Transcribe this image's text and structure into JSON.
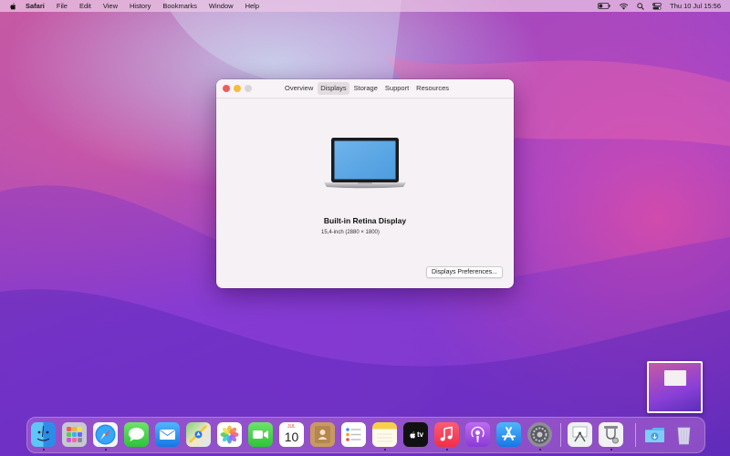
{
  "menubar": {
    "app_name": "Safari",
    "items": [
      "File",
      "Edit",
      "View",
      "History",
      "Bookmarks",
      "Window",
      "Help"
    ],
    "clock": "Thu 10 Jul  15:56",
    "status_icons": [
      "battery-icon",
      "wifi-icon",
      "search-icon",
      "control-center-icon"
    ]
  },
  "window": {
    "tabs": [
      "Overview",
      "Displays",
      "Storage",
      "Support",
      "Resources"
    ],
    "active_tab": "Displays",
    "display_name": "Built-in Retina Display",
    "display_spec": "15,4-inch (2880 × 1800)",
    "preferences_button": "Displays Preferences..."
  },
  "dock": {
    "apps": [
      {
        "name": "Finder",
        "icon": "finder-icon",
        "running": true
      },
      {
        "name": "Launchpad",
        "icon": "launchpad-icon",
        "running": false
      },
      {
        "name": "Safari",
        "icon": "safari-icon",
        "running": true
      },
      {
        "name": "Messages",
        "icon": "messages-icon",
        "running": false
      },
      {
        "name": "Mail",
        "icon": "mail-icon",
        "running": false
      },
      {
        "name": "Maps",
        "icon": "maps-icon",
        "running": false
      },
      {
        "name": "Photos",
        "icon": "photos-icon",
        "running": false
      },
      {
        "name": "FaceTime",
        "icon": "facetime-icon",
        "running": false
      },
      {
        "name": "Calendar",
        "icon": "calendar-icon",
        "running": false
      },
      {
        "name": "Contacts",
        "icon": "contacts-icon",
        "running": false
      },
      {
        "name": "Reminders",
        "icon": "reminders-icon",
        "running": false
      },
      {
        "name": "Notes",
        "icon": "notes-icon",
        "running": true
      },
      {
        "name": "TV",
        "icon": "tv-icon",
        "running": false
      },
      {
        "name": "Music",
        "icon": "music-icon",
        "running": true
      },
      {
        "name": "Podcasts",
        "icon": "podcasts-icon",
        "running": false
      },
      {
        "name": "App Store",
        "icon": "app-store-icon",
        "running": false
      },
      {
        "name": "System Preferences",
        "icon": "system-preferences-icon",
        "running": true
      },
      {
        "name": "Preview",
        "icon": "preview-icon",
        "running": false
      },
      {
        "name": "System Information",
        "icon": "system-information-icon",
        "running": true
      },
      {
        "name": "Downloads",
        "icon": "downloads-folder-icon",
        "running": false
      },
      {
        "name": "Trash",
        "icon": "trash-icon",
        "running": false
      }
    ],
    "calendar_month": "JUL",
    "calendar_day": "10",
    "tv_label": "tv"
  },
  "colors": {
    "close": "#ec5f57",
    "minimize": "#f4bd3a",
    "maximize_inactive": "#d9d4d7",
    "screen_blue": "#5aa7e6"
  }
}
